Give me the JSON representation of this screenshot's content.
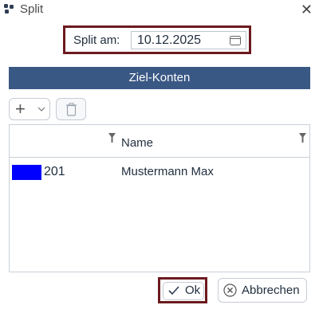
{
  "window": {
    "title": "Split",
    "icon": "app-icon",
    "close_icon": "close-icon"
  },
  "split": {
    "label": "Split am:",
    "date_value": "10.12.2025",
    "date_icon": "calendar-icon"
  },
  "section": {
    "header": "Ziel-Konten"
  },
  "toolbar": {
    "add_icon": "plus-icon",
    "dropdown_icon": "chevron-down-icon",
    "delete_icon": "trash-icon"
  },
  "grid": {
    "columns": [
      "",
      "Name"
    ],
    "rows": [
      {
        "color": "#0000ff",
        "number": "201",
        "name": "Mustermann Max"
      }
    ]
  },
  "buttons": {
    "ok_label": "Ok",
    "cancel_label": "Abbrechen"
  },
  "colors": {
    "accent": "#3a5884",
    "highlight_border": "#6b1a1f",
    "swatch": "#0000ff"
  }
}
